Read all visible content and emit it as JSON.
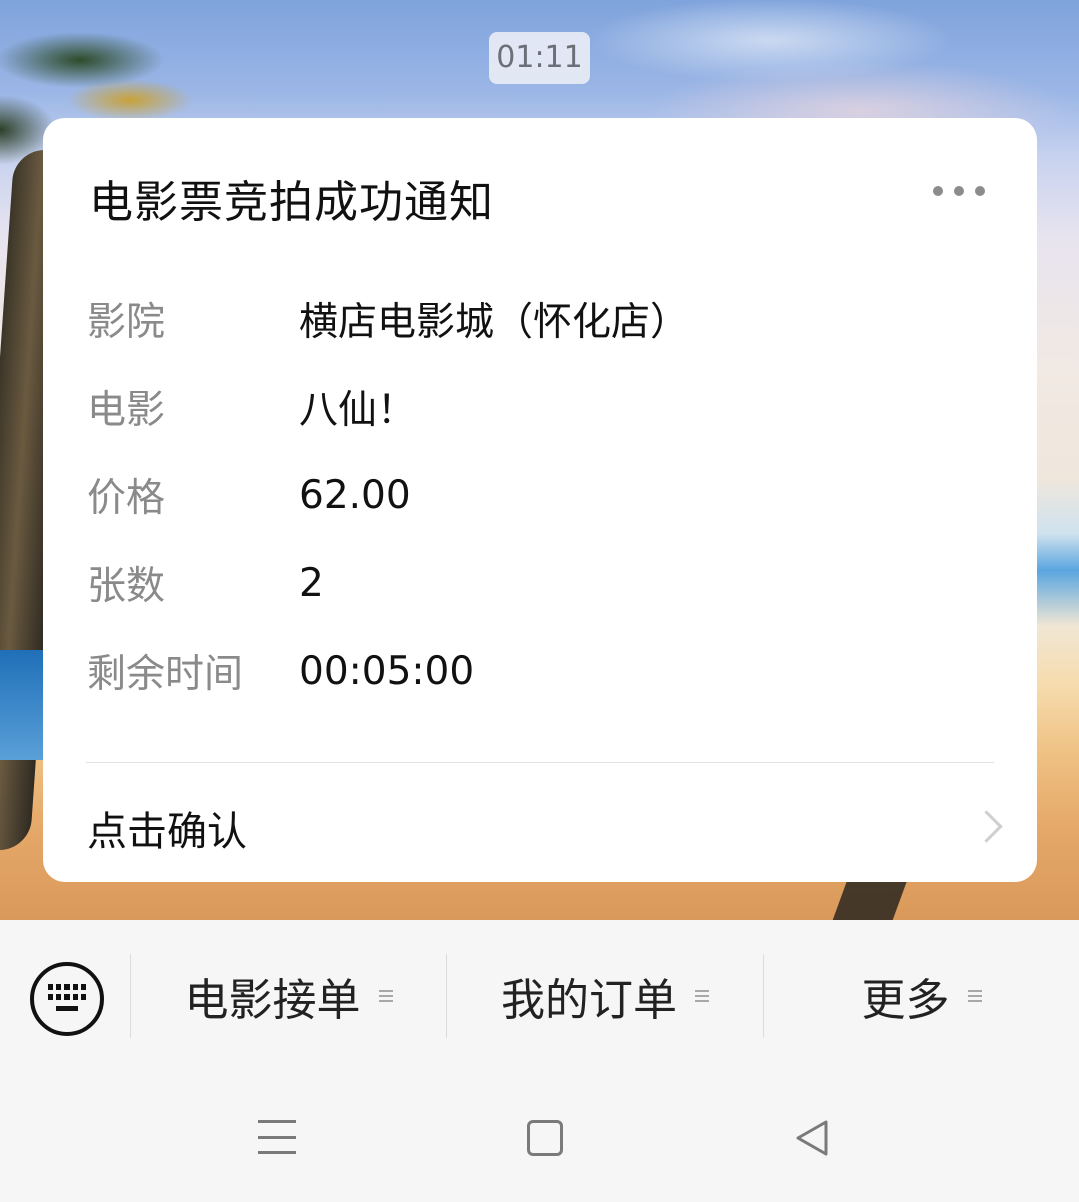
{
  "timestamp": "01:11",
  "card": {
    "title": "电影票竞拍成功通知",
    "more_icon": "more-dots-icon",
    "rows": [
      {
        "label": "影院",
        "value": "横店电影城（怀化店）"
      },
      {
        "label": "电影",
        "value": "八仙！"
      },
      {
        "label": "价格",
        "value": "62.00"
      },
      {
        "label": "张数",
        "value": "2"
      },
      {
        "label": "剩余时间",
        "value": "00:05:00"
      }
    ],
    "confirm_label": "点击确认"
  },
  "menu": {
    "keyboard_icon": "keyboard-icon",
    "items": [
      {
        "label": "电影接单"
      },
      {
        "label": "我的订单"
      },
      {
        "label": "更多"
      }
    ]
  },
  "navbar": {
    "icons": [
      "menu-icon",
      "home-square-icon",
      "back-triangle-icon"
    ]
  }
}
